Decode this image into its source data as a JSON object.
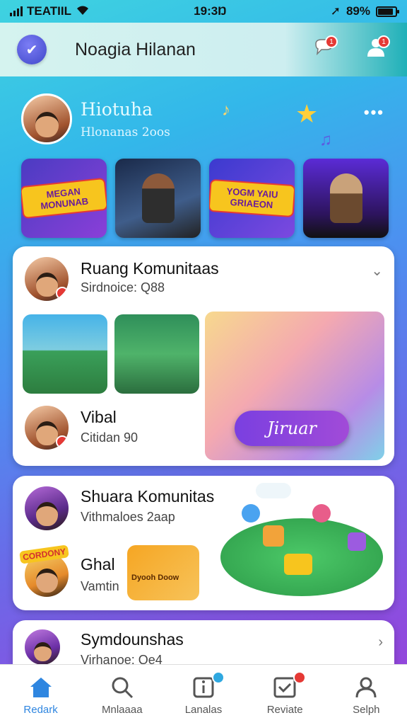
{
  "status_bar": {
    "carrier": "TEATIIL",
    "time": "19:3Ŋ",
    "battery": "89%",
    "battery_level": 0.89
  },
  "header": {
    "title": "Noagia Hilanan",
    "logo_icon": "check-shield-icon",
    "notifications_icon": "chat-bell-icon",
    "profile_icon": "user-icon"
  },
  "profile": {
    "name": "Hiotuha",
    "subtitle": "Hlonanas 2oos"
  },
  "thumbnails": [
    {
      "label": "MEGAN MONUNAB",
      "kind": "poster"
    },
    {
      "label": "",
      "kind": "guitar-player"
    },
    {
      "label": "YOGM YAIU GRIAEON",
      "kind": "poster"
    },
    {
      "label": "",
      "kind": "concert"
    }
  ],
  "card1": {
    "title": "Ruang Komunitaas",
    "subtitle": "Sirdnoice: Q88",
    "member_name": "Vibal",
    "member_sub": "Citidan 90",
    "join_label": "Jiruar"
  },
  "card2": {
    "title": "Shuara Komunitas",
    "subtitle": "Vithmaloes 2aap",
    "member_name": "Ghal",
    "member_sub": "Vamtin",
    "badge_text": "CORDONY",
    "poster_text": "Dyooh Doow"
  },
  "card3": {
    "title": "Symdounshas",
    "subtitle": "Virhanoe: Qe4"
  },
  "bottom_nav": [
    {
      "label": "Redark",
      "icon": "home-icon",
      "active": true
    },
    {
      "label": "Mnlaaaa",
      "icon": "search-icon",
      "active": false
    },
    {
      "label": "Lanalas",
      "icon": "info-icon",
      "active": false
    },
    {
      "label": "Reviate",
      "icon": "chart-icon",
      "active": false
    },
    {
      "label": "Selph",
      "icon": "user-icon",
      "active": false
    }
  ],
  "colors": {
    "accent": "#2f86e0",
    "badge": "#e53935",
    "join_button": "#8a45dc"
  }
}
